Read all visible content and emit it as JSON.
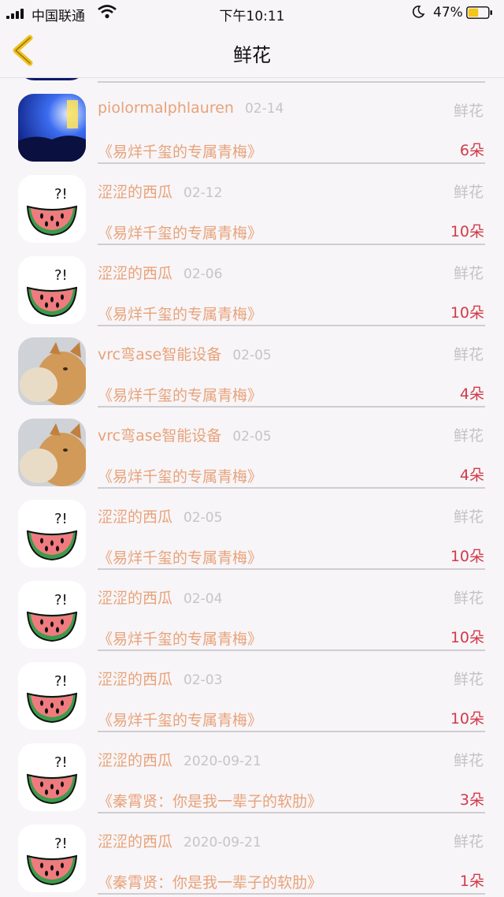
{
  "status": {
    "carrier": "中国联通",
    "time": "下午10:11",
    "battery": "47%"
  },
  "nav": {
    "title": "鲜花",
    "back_icon": "chevron-left-icon"
  },
  "colors": {
    "name": "#e8a27a",
    "count": "#d23a4a",
    "muted": "#c4c2c4",
    "back": "#f0c020"
  },
  "rows": [
    {
      "avatar": "concert",
      "name": "piolormalphlauren",
      "date": "02-14",
      "type": "鲜花",
      "book": "《易烊千玺的专属青梅》",
      "count": "6朵"
    },
    {
      "avatar": "watermelon",
      "name": "涩涩的西瓜",
      "date": "02-12",
      "type": "鲜花",
      "book": "《易烊千玺的专属青梅》",
      "count": "10朵"
    },
    {
      "avatar": "watermelon",
      "name": "涩涩的西瓜",
      "date": "02-06",
      "type": "鲜花",
      "book": "《易烊千玺的专属青梅》",
      "count": "10朵"
    },
    {
      "avatar": "cats",
      "name": "vrc弯ase智能设备",
      "date": "02-05",
      "type": "鲜花",
      "book": "《易烊千玺的专属青梅》",
      "count": "4朵"
    },
    {
      "avatar": "cats",
      "name": "vrc弯ase智能设备",
      "date": "02-05",
      "type": "鲜花",
      "book": "《易烊千玺的专属青梅》",
      "count": "4朵"
    },
    {
      "avatar": "watermelon",
      "name": "涩涩的西瓜",
      "date": "02-05",
      "type": "鲜花",
      "book": "《易烊千玺的专属青梅》",
      "count": "10朵"
    },
    {
      "avatar": "watermelon",
      "name": "涩涩的西瓜",
      "date": "02-04",
      "type": "鲜花",
      "book": "《易烊千玺的专属青梅》",
      "count": "10朵"
    },
    {
      "avatar": "watermelon",
      "name": "涩涩的西瓜",
      "date": "02-03",
      "type": "鲜花",
      "book": "《易烊千玺的专属青梅》",
      "count": "10朵"
    },
    {
      "avatar": "watermelon",
      "name": "涩涩的西瓜",
      "date": "2020-09-21",
      "type": "鲜花",
      "book": "《秦霄贤：你是我一辈子的软肋》",
      "count": "3朵"
    },
    {
      "avatar": "watermelon",
      "name": "涩涩的西瓜",
      "date": "2020-09-21",
      "type": "鲜花",
      "book": "《秦霄贤：你是我一辈子的软肋》",
      "count": "1朵"
    }
  ]
}
